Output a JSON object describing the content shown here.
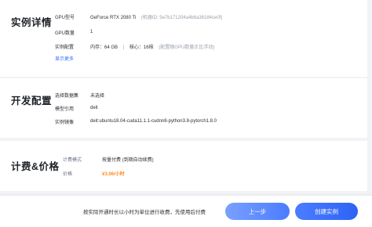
{
  "instance": {
    "title": "实例详情",
    "gpu_model_label": "GPU型号",
    "gpu_model_value": "GeForce RTX 2080 Ti",
    "gpu_id_text": "(机器ID: 5e7b171204a4b6a36184ce0f)",
    "gpu_count_label": "GPU数量",
    "gpu_count_value": "1",
    "spec_label": "实例配置",
    "spec_memory": "内存：64 GB",
    "spec_separator": "|",
    "spec_cores": "核心：16核",
    "spec_note": "(配置随GPU数量正比浮动)",
    "show_more": "显示更多"
  },
  "config": {
    "title": "开发配置",
    "dataset_label": "选择数据集",
    "dataset_value": "未选择",
    "model_label": "模型引用",
    "model_value": "deit",
    "image_label": "实例镜像",
    "image_value": "deit:ubuntu18.04-cuda11.1.1-cudnn8-python3.8-pytorch1.8.0"
  },
  "pricing": {
    "title": "计费&价格",
    "mode_label": "计费模式",
    "mode_value": "按量付费 (到期自动续费)",
    "price_label": "价格",
    "price_value": "¥3.06/小时"
  },
  "footer": {
    "note": "按实际开通时长以小时为单位进行收费，先使用后付费",
    "prev_button": "上一步",
    "create_button": "创建实例"
  },
  "colors": {
    "accent": "#2f6bff",
    "price": "#ff8a1f",
    "background": "#f2f3f6"
  }
}
